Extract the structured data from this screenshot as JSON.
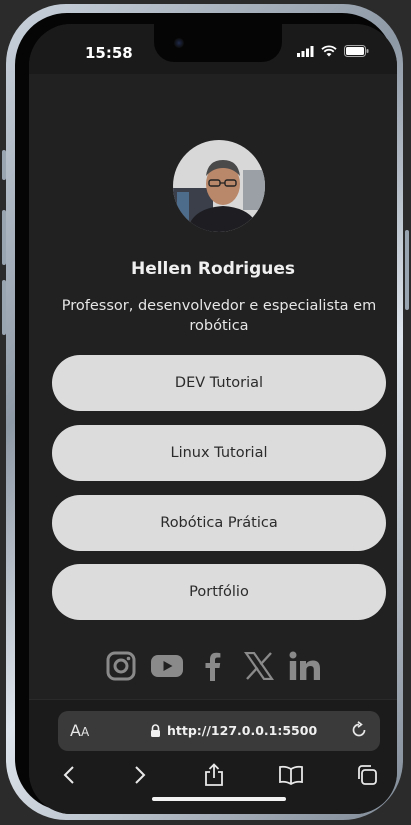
{
  "status_bar": {
    "time": "15:58"
  },
  "profile": {
    "name": "Hellen Rodrigues",
    "bio": "Professor, desenvolvedor e especialista em robótica"
  },
  "links": [
    {
      "label": "DEV Tutorial"
    },
    {
      "label": "Linux Tutorial"
    },
    {
      "label": "Robótica Prática"
    },
    {
      "label": "Portfólio"
    }
  ],
  "socials": [
    "instagram-icon",
    "youtube-icon",
    "facebook-icon",
    "x-icon",
    "linkedin-icon"
  ],
  "browser": {
    "aa_label_big": "A",
    "aa_label_small": "A",
    "url": "http://127.0.0.1:5500"
  },
  "colors": {
    "background": "#212121",
    "button": "#dcdcdc",
    "icon": "#8a8a8a"
  }
}
